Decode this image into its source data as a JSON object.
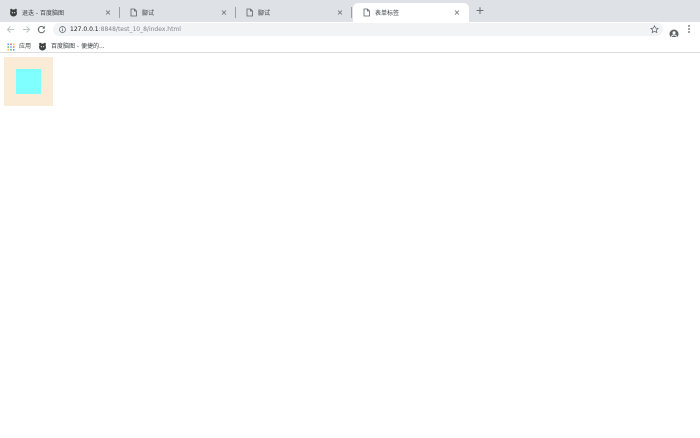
{
  "tabs": [
    {
      "title": "退迭 - 百度脑图",
      "favicon": "baidu-naotu-icon",
      "active": false
    },
    {
      "title": "腳试",
      "favicon": "document-icon",
      "active": false
    },
    {
      "title": "腳试",
      "favicon": "document-icon",
      "active": false
    },
    {
      "title": "表单标签",
      "favicon": "document-icon",
      "active": true
    }
  ],
  "newtab": {
    "label": "+"
  },
  "tab_close_glyph": "×",
  "address": {
    "host": "127.0.0.1",
    "rest": ":8848/test_10_8/index.html"
  },
  "bookmarks": [
    {
      "label": "应用",
      "icon": "apps-grid-icon"
    },
    {
      "label": "百度脑图 - 便捷的...",
      "icon": "baidu-naotu-icon"
    }
  ],
  "page": {
    "outer_box_color": "#faebd7",
    "inner_box_color": "#7fffff"
  }
}
